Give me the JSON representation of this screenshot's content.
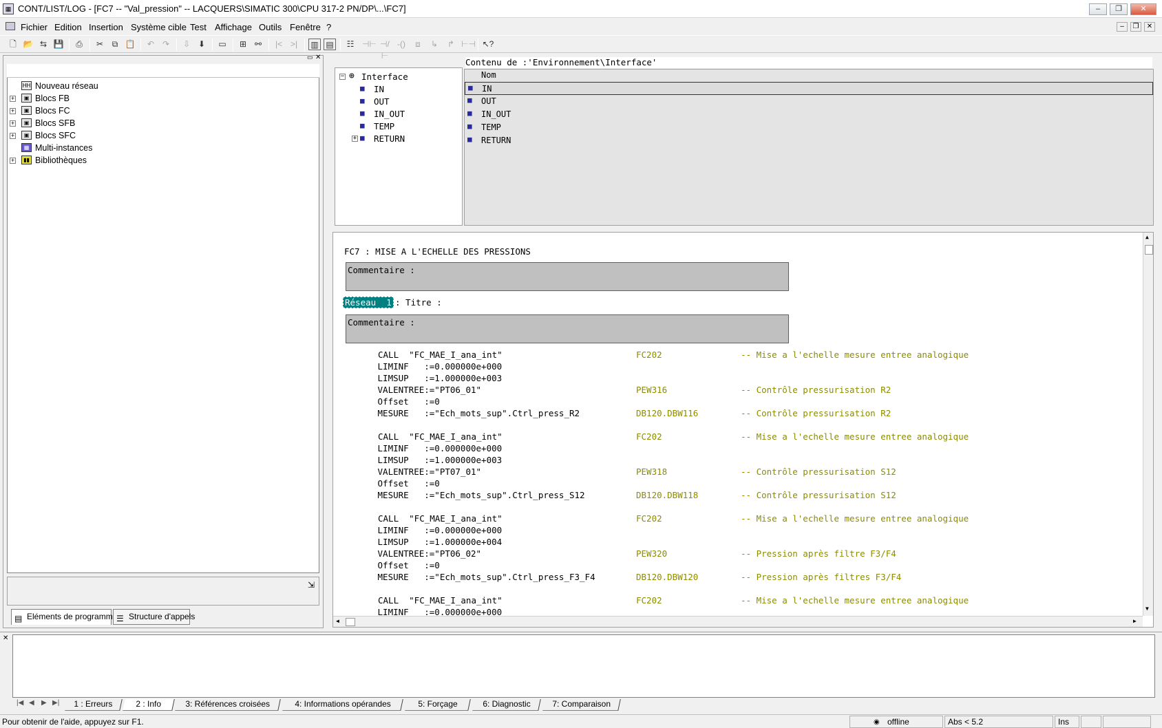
{
  "window": {
    "title": "CONT/LIST/LOG - [FC7 -- \"Val_pression\" -- LACQUERS\\SIMATIC 300\\CPU 317-2 PN/DP\\...\\FC7]"
  },
  "menu": [
    "Fichier",
    "Edition",
    "Insertion",
    "Système cible",
    "Test",
    "Affichage",
    "Outils",
    "Fenêtre",
    "?"
  ],
  "program_tree": [
    {
      "label": "Nouveau réseau",
      "icon": "network-icon",
      "expand": false
    },
    {
      "label": "Blocs FB",
      "icon": "block-icon",
      "expand": true
    },
    {
      "label": "Blocs FC",
      "icon": "block-icon",
      "expand": true
    },
    {
      "label": "Blocs SFB",
      "icon": "block-icon",
      "expand": true
    },
    {
      "label": "Blocs SFC",
      "icon": "block-icon",
      "expand": true
    },
    {
      "label": "Multi-instances",
      "icon": "multi-instance-icon",
      "expand": false
    },
    {
      "label": "Bibliothèques",
      "icon": "library-icon",
      "expand": true
    }
  ],
  "left_tabs": [
    "Eléments de programme",
    "Structure d'appels"
  ],
  "interface": {
    "root": "Interface",
    "children": [
      "IN",
      "OUT",
      "IN_OUT",
      "TEMP",
      "RETURN"
    ],
    "content_title": "Contenu de :'Environnement\\Interface'",
    "col_header": "Nom",
    "rows": [
      "IN",
      "OUT",
      "IN_OUT",
      "TEMP",
      "RETURN"
    ]
  },
  "editor": {
    "block_title": "FC7 : MISE A L'ECHELLE DES PRESSIONS",
    "comment_label": "Commentaire :",
    "network_label": "Réseau  1",
    "network_title": ": Titre :",
    "code": [
      {
        "t": "CALL  \"FC_MAE_I_ana_int\"",
        "a": "FC202",
        "c": "-- Mise a l'echelle mesure entree analogique"
      },
      {
        "t": " LIMINF   :=0.000000e+000",
        "a": "",
        "c": ""
      },
      {
        "t": " LIMSUP   :=1.000000e+003",
        "a": "",
        "c": ""
      },
      {
        "t": " VALENTREE:=\"PT06_01\"",
        "a": "PEW316",
        "c": "-- Contrôle pressurisation R2"
      },
      {
        "t": " Offset   :=0",
        "a": "",
        "c": ""
      },
      {
        "t": " MESURE   :=\"Ech_mots_sup\".Ctrl_press_R2",
        "a": "DB120.DBW116",
        "c": "-- Contrôle pressurisation R2"
      },
      {
        "t": "",
        "a": "",
        "c": ""
      },
      {
        "t": "CALL  \"FC_MAE_I_ana_int\"",
        "a": "FC202",
        "c": "-- Mise a l'echelle mesure entree analogique"
      },
      {
        "t": " LIMINF   :=0.000000e+000",
        "a": "",
        "c": ""
      },
      {
        "t": " LIMSUP   :=1.000000e+003",
        "a": "",
        "c": ""
      },
      {
        "t": " VALENTREE:=\"PT07_01\"",
        "a": "PEW318",
        "c": "-- Contrôle pressurisation S12"
      },
      {
        "t": " Offset   :=0",
        "a": "",
        "c": ""
      },
      {
        "t": " MESURE   :=\"Ech_mots_sup\".Ctrl_press_S12",
        "a": "DB120.DBW118",
        "c": "-- Contrôle pressurisation S12"
      },
      {
        "t": "",
        "a": "",
        "c": ""
      },
      {
        "t": "CALL  \"FC_MAE_I_ana_int\"",
        "a": "FC202",
        "c": "-- Mise a l'echelle mesure entree analogique"
      },
      {
        "t": " LIMINF   :=0.000000e+000",
        "a": "",
        "c": ""
      },
      {
        "t": " LIMSUP   :=1.000000e+004",
        "a": "",
        "c": ""
      },
      {
        "t": " VALENTREE:=\"PT06_02\"",
        "a": "PEW320",
        "c": "-- Pression après filtre F3/F4"
      },
      {
        "t": " Offset   :=0",
        "a": "",
        "c": ""
      },
      {
        "t": " MESURE   :=\"Ech_mots_sup\".Ctrl_press_F3_F4",
        "a": "DB120.DBW120",
        "c": "-- Pression après filtres F3/F4"
      },
      {
        "t": "",
        "a": "",
        "c": ""
      },
      {
        "t": "CALL  \"FC_MAE_I_ana_int\"",
        "a": "FC202",
        "c": "-- Mise a l'echelle mesure entree analogique"
      },
      {
        "t": " LIMINF   :=0.000000e+000",
        "a": "",
        "c": ""
      }
    ]
  },
  "output_tabs": [
    "1 : Erreurs",
    "2 : Info",
    "3: Références croisées",
    "4: Informations opérandes",
    "5: Forçage",
    "6: Diagnostic",
    "7: Comparaison"
  ],
  "status": {
    "help": "Pour obtenir de l'aide, appuyez sur F1.",
    "mode": "offline",
    "abs": "Abs < 5.2",
    "ins": "Ins"
  },
  "colors": {
    "code_green": "#8c8c00",
    "network_teal": "#008080"
  }
}
